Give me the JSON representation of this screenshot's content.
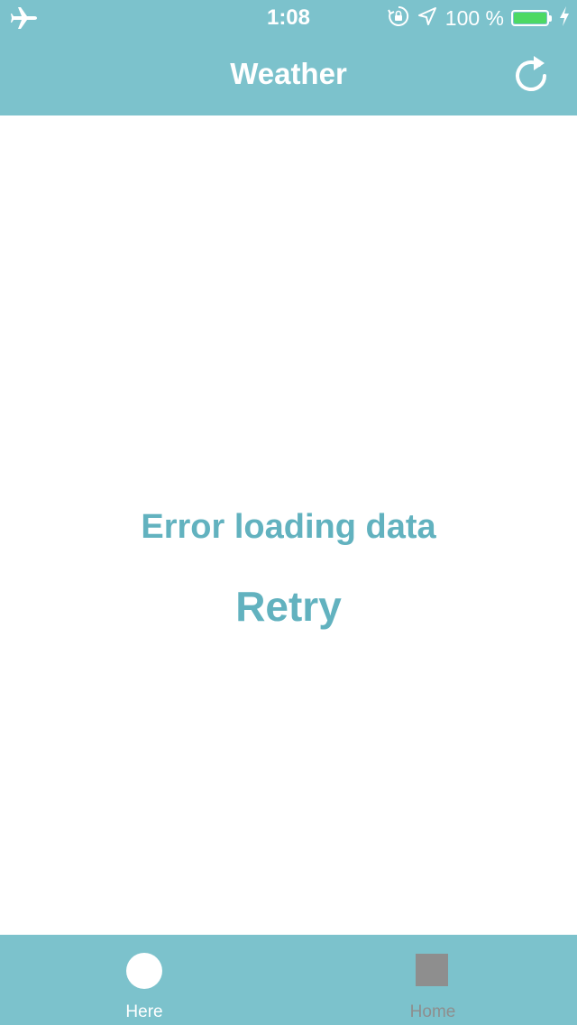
{
  "status_bar": {
    "time": "1:08",
    "battery_percent": "100 %",
    "battery_level": 1.0,
    "icons": [
      "airplane-mode-icon",
      "rotation-lock-icon",
      "location-arrow-icon",
      "battery-icon",
      "charging-bolt-icon"
    ]
  },
  "nav": {
    "title": "Weather",
    "refresh_icon": "refresh-icon"
  },
  "main": {
    "error_message": "Error loading data",
    "retry_label": "Retry"
  },
  "tab_bar": {
    "tabs": [
      {
        "label": "Here",
        "icon": "circle-icon",
        "active": true
      },
      {
        "label": "Home",
        "icon": "square-icon",
        "active": false
      }
    ]
  },
  "colors": {
    "header_background": "#7cc2cc",
    "accent_text": "#62b2bf",
    "battery_fill": "#4cd964",
    "inactive_tab": "#8e8e8e"
  }
}
